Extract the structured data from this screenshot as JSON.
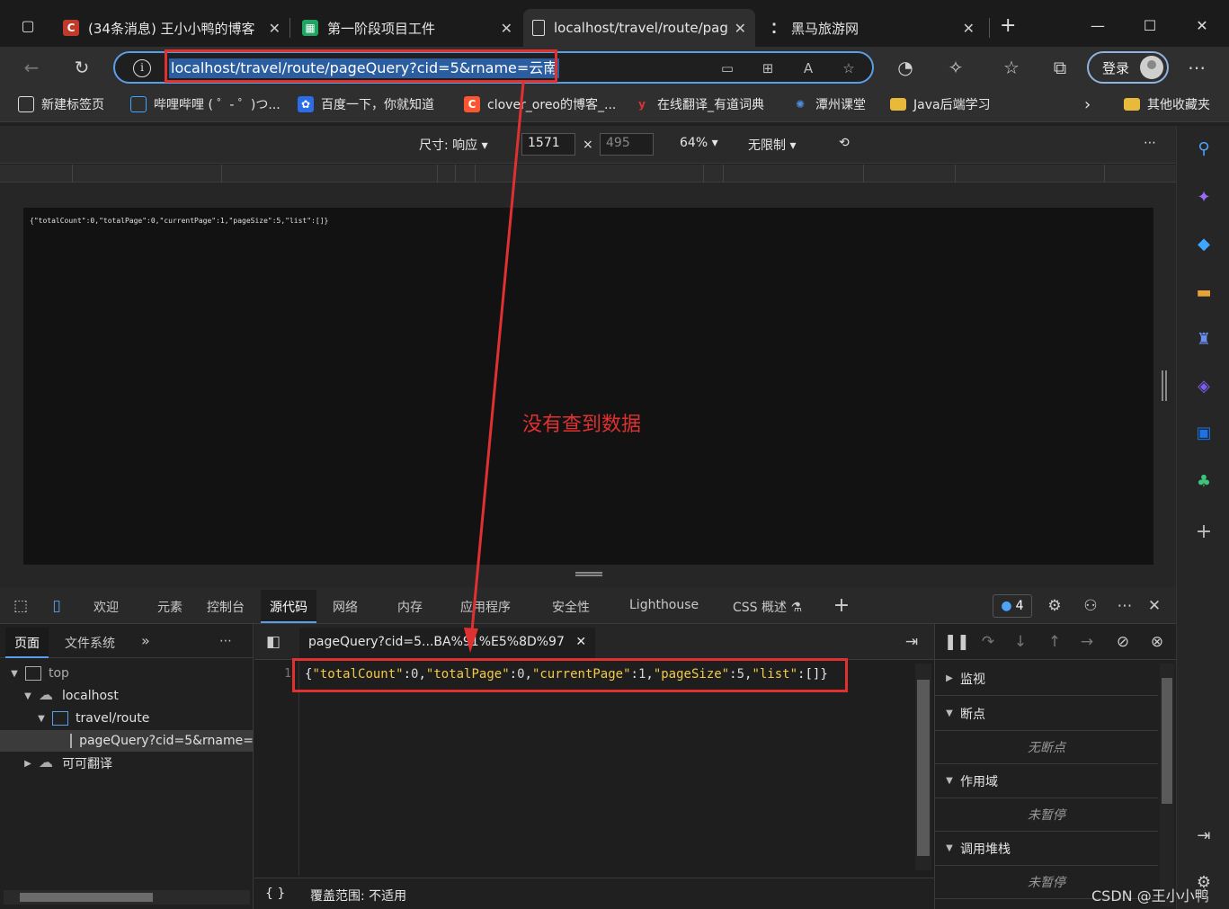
{
  "tabs": [
    {
      "title": "(34条消息) 王小小鸭的博客",
      "favicon": "C",
      "favicon_color": "#c0392b"
    },
    {
      "title": "第一阶段项目工件",
      "favicon": "▦",
      "favicon_color": "#1fa463"
    },
    {
      "title": "localhost/travel/route/page",
      "favicon": "▯",
      "favicon_color": "#2f2f2f"
    },
    {
      "title": "黑马旅游网",
      "favicon": "⁚",
      "favicon_color": "#1b1b1b"
    }
  ],
  "address": {
    "url": "localhost/travel/route/pageQuery?cid=5&rname=云南"
  },
  "login_label": "登录",
  "bookmarks": [
    {
      "label": "新建标签页",
      "icon": "new-tab-icon"
    },
    {
      "label": "哔哩哔哩 ( ゜- ゜)つ...",
      "icon": "bilibili-icon"
    },
    {
      "label": "百度一下，你就知道",
      "icon": "baidu-icon"
    },
    {
      "label": "clover_oreo的博客_...",
      "icon": "csdn-icon"
    },
    {
      "label": "在线翻译_有道词典",
      "icon": "youdao-icon"
    },
    {
      "label": "潭州课堂",
      "icon": "tanzhou-icon"
    },
    {
      "label": "Java后端学习",
      "icon": "folder-icon"
    },
    {
      "label": "其他收藏夹",
      "icon": "folder-icon"
    }
  ],
  "device_toolbar": {
    "dimensions_label": "尺寸: 响应",
    "width": "1571",
    "height": "495",
    "zoom": "64%",
    "throttle": "无限制"
  },
  "page_json_preview": "{\"totalCount\":0,\"totalPage\":0,\"currentPage\":1,\"pageSize\":5,\"list\":[]}",
  "annotation": "没有查到数据",
  "devtools": {
    "tabs": [
      "欢迎",
      "元素",
      "控制台",
      "源代码",
      "网络",
      "内存",
      "应用程序",
      "安全性",
      "Lighthouse",
      "CSS 概述"
    ],
    "issues_count": "4",
    "navigator_tabs": [
      "页面",
      "文件系统"
    ],
    "tree": [
      {
        "label": "top"
      },
      {
        "label": "localhost"
      },
      {
        "label": "travel/route"
      },
      {
        "label": "pageQuery?cid=5&rname="
      },
      {
        "label": "可可翻译"
      }
    ],
    "editor_tab": "pageQuery?cid=5...BA%91%E5%8D%97",
    "line_number": "1",
    "code": {
      "k1": "\"totalCount\"",
      "v1": "0",
      "k2": "\"totalPage\"",
      "v2": "0",
      "k3": "\"currentPage\"",
      "v3": "1",
      "k4": "\"pageSize\"",
      "v4": "5",
      "k5": "\"list\"",
      "v5": "[]"
    },
    "status_braces": "{ }",
    "coverage": "覆盖范围: 不适用",
    "debugger": {
      "watch": "监视",
      "breakpoints": "断点",
      "no_breakpoints": "无断点",
      "scope": "作用域",
      "not_paused": "未暂停",
      "callstack": "调用堆栈",
      "not_paused_2": "未暂停"
    }
  },
  "watermark": "CSDN @王小小鸭"
}
